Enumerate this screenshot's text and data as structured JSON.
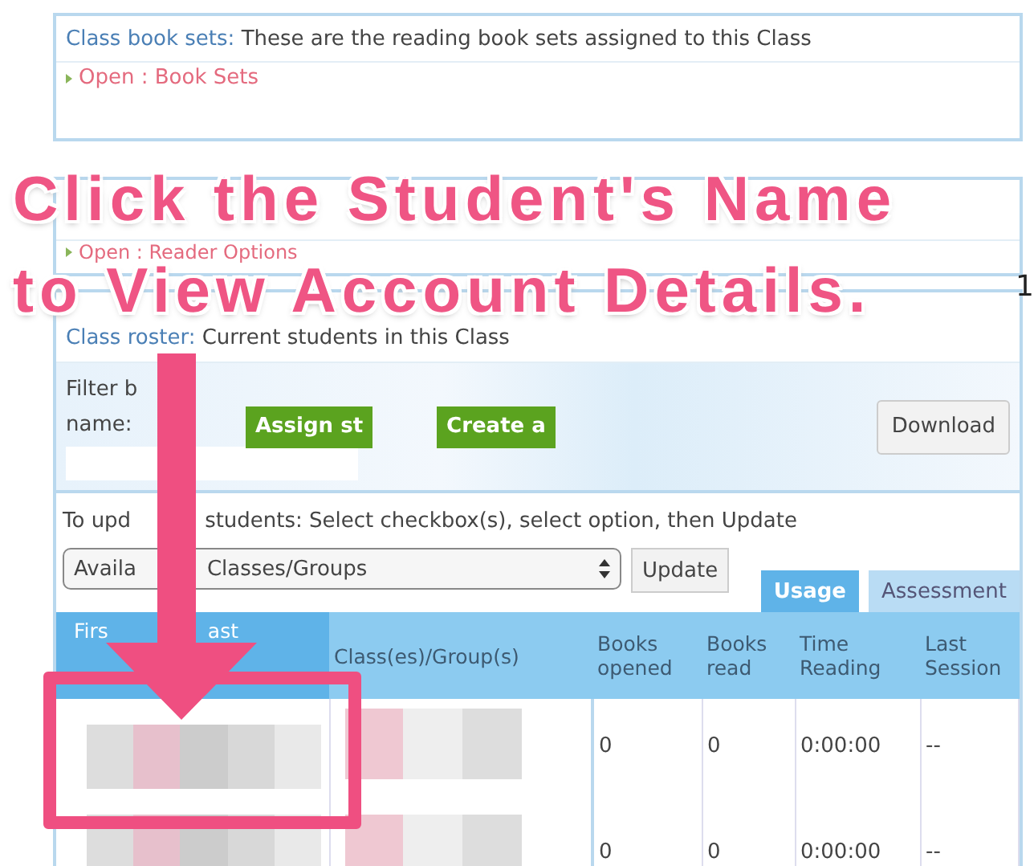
{
  "book_sets": {
    "label": "Class book sets:",
    "text": "These are the reading book sets assigned to this Class",
    "link": "Open : Book Sets"
  },
  "reader_options": {
    "link": "Open : Reader Options"
  },
  "page_marker": "1",
  "roster": {
    "label": "Class roster:",
    "text": "Current students in this Class",
    "filter_label": [
      "Filter b",
      "name:"
    ],
    "buttons": [
      "Assign st",
      "Create a"
    ],
    "download": "Download",
    "instructions": [
      "To upd",
      "students: Select checkbox(s), select option, then Update"
    ],
    "select_value": [
      "Availa",
      "Classes/Groups"
    ],
    "update": "Update"
  },
  "table": {
    "tabs": [
      {
        "label": "Usage",
        "selected": true
      },
      {
        "label": "Assessment",
        "selected": false
      }
    ],
    "name_column": [
      "Firs",
      "ast"
    ],
    "columns": [
      "Class(es)/Group(s)",
      "Books opened",
      "Books read",
      "Time Reading",
      "Last Session"
    ],
    "rows": [
      {
        "books_opened": "0",
        "books_read": "0",
        "time_reading": "0:00:00",
        "last_session": "--"
      },
      {
        "books_opened": "0",
        "books_read": "0",
        "time_reading": "0:00:00",
        "last_session": "--"
      }
    ]
  },
  "annotation": {
    "lines": [
      "Click the Student's Name",
      "to View Account Details."
    ]
  }
}
